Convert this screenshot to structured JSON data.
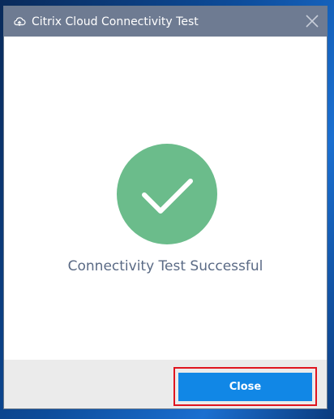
{
  "window": {
    "title": "Citrix Cloud Connectivity Test",
    "title_icon": "cloud-upload-icon",
    "close_icon": "close-icon"
  },
  "content": {
    "status_icon": "check-circle-icon",
    "status_color": "#6bbc8b",
    "message": "Connectivity Test Successful"
  },
  "footer": {
    "close_label": "Close",
    "accent": "#1187e6",
    "highlight_color": "#e0151f"
  }
}
